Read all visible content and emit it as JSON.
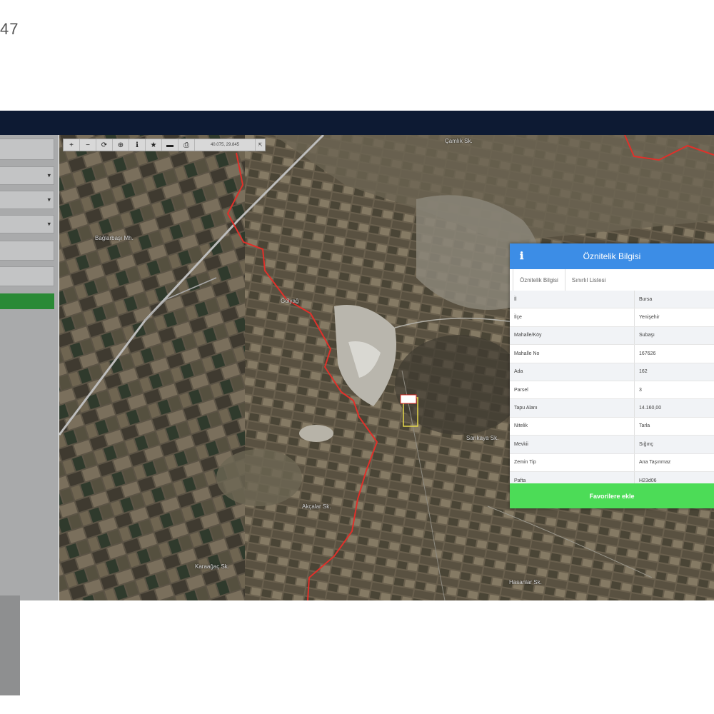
{
  "corner_number": "47",
  "toolbar": {
    "buttons": [
      {
        "icon": "zoom-in-icon",
        "glyph": "+"
      },
      {
        "icon": "zoom-out-icon",
        "glyph": "−"
      },
      {
        "icon": "refresh-icon",
        "glyph": "⟳"
      },
      {
        "icon": "locate-icon",
        "glyph": "⊕"
      },
      {
        "icon": "info-tool-icon",
        "glyph": "ℹ"
      },
      {
        "icon": "star-icon",
        "glyph": "★"
      },
      {
        "icon": "measure-icon",
        "glyph": "▬"
      },
      {
        "icon": "print-icon",
        "glyph": "⎙"
      }
    ],
    "coordinates": "40.075, 29.845",
    "last_button": "⇱"
  },
  "map_labels": [
    {
      "text": "Bağlarbaşı Mh."
    },
    {
      "text": "Gölyağ"
    },
    {
      "text": "Çamlık Sk."
    },
    {
      "text": "Akçalar Sk."
    },
    {
      "text": "Karaağaç Sk."
    },
    {
      "text": "Sarıkaya Sk."
    },
    {
      "text": "Hasanlar Sk."
    }
  ],
  "panel": {
    "title": "Öznitelik Bilgisi",
    "info_icon": "ℹ",
    "tabs": [
      {
        "label": "Öznitelik Bilgisi",
        "active": true
      },
      {
        "label": "Sınırlıl Listesi",
        "active": false
      }
    ],
    "rows": [
      {
        "key": "İl",
        "value": "Bursa"
      },
      {
        "key": "İlçe",
        "value": "Yenişehir"
      },
      {
        "key": "Mahalle/Köy",
        "value": "Subaşı"
      },
      {
        "key": "Mahalle No",
        "value": "167626"
      },
      {
        "key": "Ada",
        "value": "162"
      },
      {
        "key": "Parsel",
        "value": "3"
      },
      {
        "key": "Tapu Alanı",
        "value": "14.160,00"
      },
      {
        "key": "Nitelik",
        "value": "Tarla"
      },
      {
        "key": "Mevkii",
        "value": "Sığınç"
      },
      {
        "key": "Zemin Tip",
        "value": "Ana Taşınmaz"
      },
      {
        "key": "Pafta",
        "value": "H23d06"
      }
    ],
    "favorite_button": "Favorilere ekle"
  },
  "colors": {
    "header": "#0d1a33",
    "panel_header": "#3c8de6",
    "favorite_button": "#4cdc57",
    "boundary_line": "#e0302a",
    "sidebar_green": "#2a8a36"
  }
}
